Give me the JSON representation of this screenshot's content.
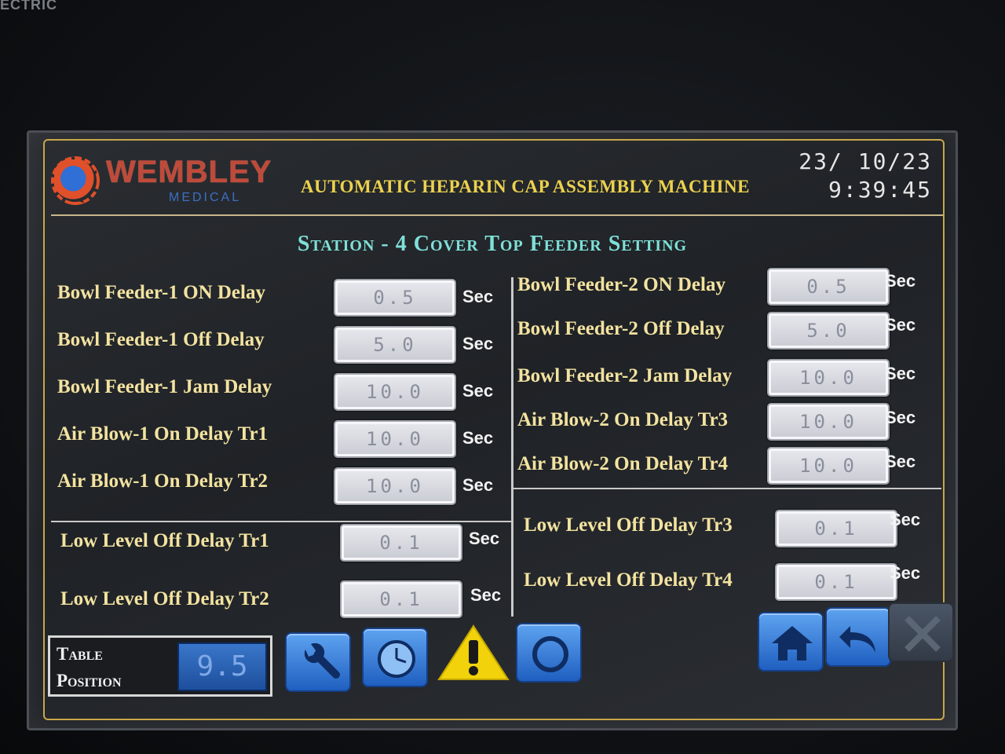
{
  "bezel": {
    "brand_text": "ECTRIC"
  },
  "header": {
    "logo_text": "WEMBLEY",
    "logo_subtext": "MEDICAL",
    "title": "AUTOMATIC HEPARIN CAP ASSEMBLY MACHINE",
    "date": "23/ 10/23",
    "time": "9:39:45"
  },
  "station_title": "Station - 4 Cover Top Feeder Setting",
  "left_settings": [
    {
      "label": "Bowl Feeder-1 ON Delay",
      "value": "0.5",
      "unit": "Sec"
    },
    {
      "label": "Bowl Feeder-1 Off Delay",
      "value": "5.0",
      "unit": "Sec"
    },
    {
      "label": "Bowl Feeder-1 Jam Delay",
      "value": "10.0",
      "unit": "Sec"
    },
    {
      "label": "Air Blow-1 On Delay Tr1",
      "value": "10.0",
      "unit": "Sec"
    },
    {
      "label": "Air Blow-1 On Delay Tr2",
      "value": "10.0",
      "unit": "Sec"
    }
  ],
  "right_settings": [
    {
      "label": "Bowl Feeder-2 ON Delay",
      "value": "0.5",
      "unit": "Sec"
    },
    {
      "label": "Bowl Feeder-2 Off Delay",
      "value": "5.0",
      "unit": "Sec"
    },
    {
      "label": "Bowl Feeder-2 Jam Delay",
      "value": "10.0",
      "unit": "Sec"
    },
    {
      "label": "Air Blow-2 On Delay Tr3",
      "value": "10.0",
      "unit": "Sec"
    },
    {
      "label": "Air Blow-2 On Delay Tr4",
      "value": "10.0",
      "unit": "Sec"
    }
  ],
  "left_low_level": [
    {
      "label": "Low Level Off Delay Tr1",
      "value": "0.1",
      "unit": "Sec"
    },
    {
      "label": "Low Level Off Delay Tr2",
      "value": "0.1",
      "unit": "Sec"
    }
  ],
  "right_low_level": [
    {
      "label": "Low Level Off Delay Tr3",
      "value": "0.1",
      "unit": "Sec"
    },
    {
      "label": "Low Level Off Delay Tr4",
      "value": "0.1",
      "unit": "Sec"
    }
  ],
  "footer": {
    "table_label_1": "Table",
    "table_label_2": "Position",
    "table_value": "9.5",
    "icons": [
      "wrench-icon",
      "clock-icon",
      "warning-icon",
      "circle-icon",
      "home-icon",
      "back-icon",
      "close-icon"
    ]
  }
}
